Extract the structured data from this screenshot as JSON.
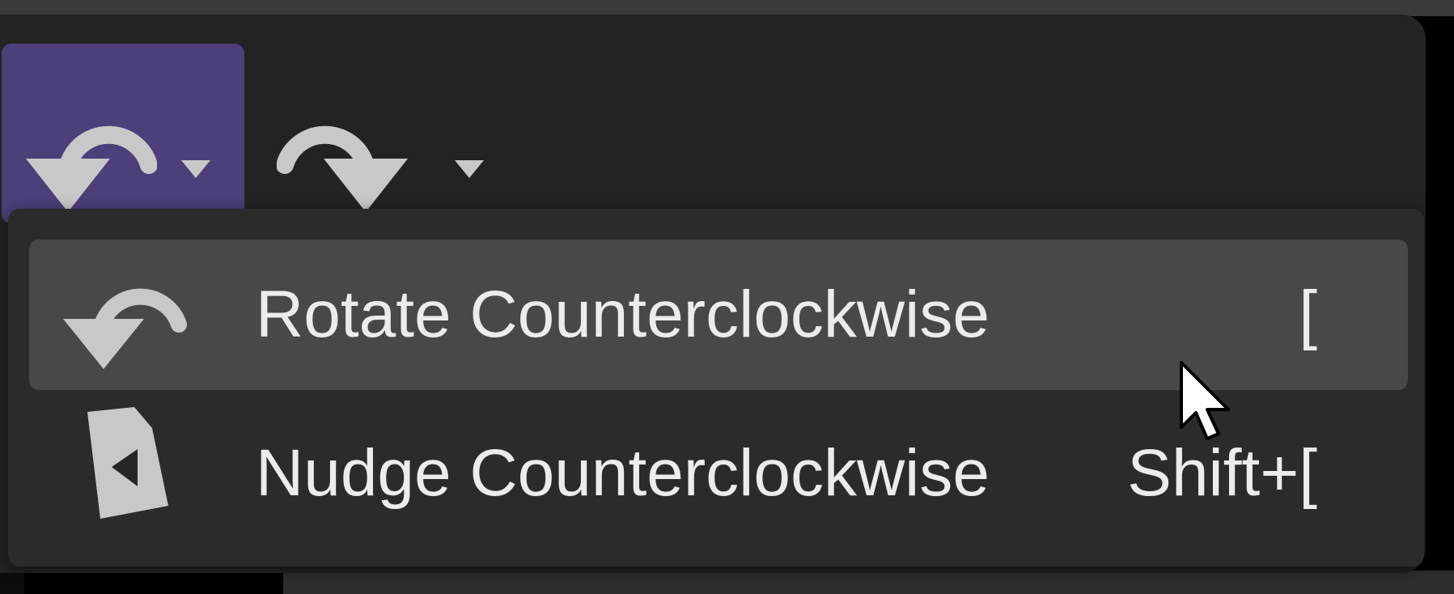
{
  "toolbar": {
    "buttons": [
      {
        "name": "rotate-counterclockwise",
        "icon": "rotate-ccw-icon",
        "active": true
      },
      {
        "name": "rotate-clockwise",
        "icon": "rotate-cw-icon",
        "active": false
      }
    ]
  },
  "menu": {
    "items": [
      {
        "label": "Rotate Counterclockwise",
        "shortcut": "[",
        "icon": "rotate-ccw-icon",
        "highlighted": true
      },
      {
        "label": "Nudge Counterclockwise",
        "shortcut": "Shift+[",
        "icon": "nudge-ccw-icon",
        "highlighted": false
      }
    ]
  },
  "colors": {
    "active_button": "#4d3f7a",
    "menu_background": "#2b2b2b",
    "menu_highlight": "#484848",
    "icon": "#c8c8c8",
    "text": "#ececec"
  }
}
